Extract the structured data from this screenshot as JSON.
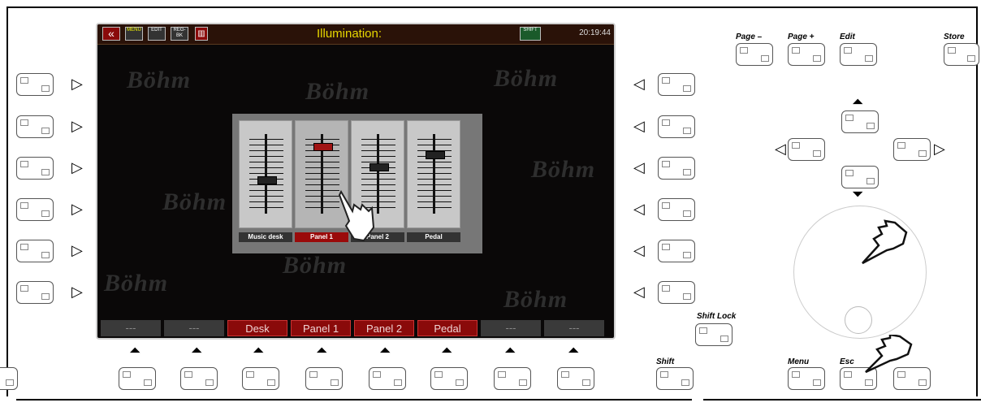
{
  "screen": {
    "title": "Illumination:",
    "clock": "20:19:44",
    "toolbar_icons": [
      "back-icon",
      "menu-icon",
      "edit-icon",
      "registration-icon",
      "delete-icon",
      "shift-icon"
    ],
    "toolbar_labels": {
      "back": "«",
      "menu": "MENU",
      "edit": "EDIT",
      "reg": "REG-BK",
      "delete": "",
      "shift": "SHIFT"
    },
    "watermark": "Böhm",
    "faders": [
      {
        "label": "Music desk",
        "level": 0.45,
        "selected": false
      },
      {
        "label": "Panel 1",
        "level": 0.88,
        "selected": true
      },
      {
        "label": "Panel 2",
        "level": 0.62,
        "selected": false
      },
      {
        "label": "Pedal",
        "level": 0.78,
        "selected": false
      }
    ],
    "softkeys": [
      "---",
      "---",
      "Desk",
      "Panel 1",
      "Panel 2",
      "Pedal",
      "---",
      "---"
    ]
  },
  "hardware": {
    "page_minus": "Page –",
    "page_plus": "Page +",
    "edit": "Edit",
    "store": "Store",
    "shift_lock": "Shift Lock",
    "shift": "Shift",
    "menu": "Menu",
    "esc": "Esc"
  },
  "colors": {
    "title": "#e8d800",
    "screen_bg": "#0a0808",
    "selected": "#9a0a0a"
  }
}
